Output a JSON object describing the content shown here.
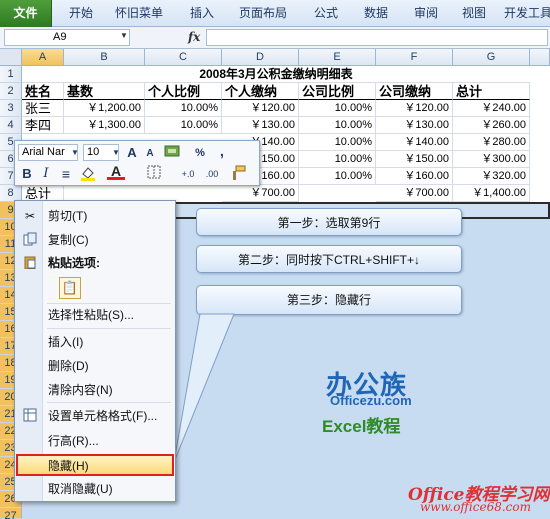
{
  "ribbon": {
    "tabs": [
      "文件",
      "开始",
      "怀旧菜单",
      "插入",
      "页面布局",
      "公式",
      "数据",
      "审阅",
      "视图",
      "开发工具"
    ]
  },
  "formula_bar": {
    "name_box": "A9",
    "fx": "fx",
    "formula": ""
  },
  "grid": {
    "columns": [
      "A",
      "B",
      "C",
      "D",
      "E",
      "F",
      "G"
    ],
    "rows": [
      "1",
      "2",
      "3",
      "4",
      "5",
      "6",
      "7",
      "8",
      "9",
      "10",
      "11",
      "12",
      "13",
      "14",
      "15",
      "16",
      "17",
      "18",
      "19",
      "20",
      "21",
      "22",
      "23",
      "24",
      "25",
      "26",
      "27"
    ],
    "title": "2008年3月公积金缴纳明细表",
    "headers": [
      "姓名",
      "基数",
      "个人比例",
      "个人缴纳",
      "公司比例",
      "公司缴纳",
      "总计"
    ],
    "data_rows": [
      [
        "张三",
        "￥1,200.00",
        "10.00%",
        "￥120.00",
        "10.00%",
        "￥120.00",
        "￥240.00"
      ],
      [
        "李四",
        "￥1,300.00",
        "10.00%",
        "￥130.00",
        "10.00%",
        "￥130.00",
        "￥260.00"
      ],
      [
        "",
        "",
        "",
        "￥140.00",
        "10.00%",
        "￥140.00",
        "￥280.00"
      ],
      [
        "",
        "",
        "",
        "￥150.00",
        "10.00%",
        "￥150.00",
        "￥300.00"
      ],
      [
        "",
        "",
        "",
        "￥160.00",
        "10.00%",
        "￥160.00",
        "￥320.00"
      ],
      [
        "总计",
        "",
        "",
        "￥700.00",
        "",
        "￥700.00",
        "￥1,400.00"
      ]
    ]
  },
  "mini_toolbar": {
    "font_name": "Arial Nar",
    "font_size": "10",
    "btn_grow": "A",
    "btn_shrink": "A",
    "btn_percent": "%",
    "btn_comma": ",",
    "btn_bold": "B",
    "btn_italic": "I",
    "btn_font_color": "A",
    "btn_inc_decimal": "+.0",
    "btn_dec_decimal": ".00"
  },
  "context_menu": {
    "items": {
      "cut": "剪切(T)",
      "copy": "复制(C)",
      "paste_options": "粘贴选项:",
      "paste_special": "选择性粘贴(S)...",
      "insert": "插入(I)",
      "delete": "删除(D)",
      "clear": "清除内容(N)",
      "format_cells": "设置单元格格式(F)...",
      "row_height": "行高(R)...",
      "hide": "隐藏(H)",
      "unhide": "取消隐藏(U)"
    }
  },
  "steps": {
    "step1": "第一步：选取第9行",
    "step2": "第二步：同时按下CTRL+SHIFT+↓",
    "step3": "第三步：隐藏行"
  },
  "logo": {
    "brand": "办公族",
    "domain": "Officezu.com",
    "course": "Excel教程"
  },
  "watermark": {
    "line1": "Office教程学习网",
    "line2": "www.office68.com"
  }
}
